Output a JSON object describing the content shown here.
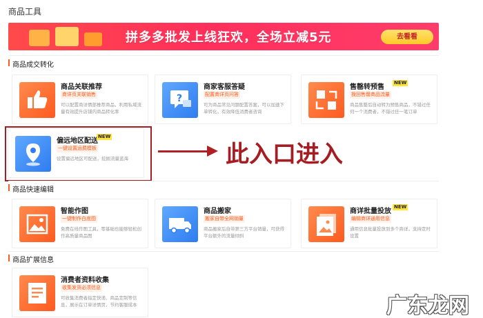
{
  "header": {
    "title": "商品工具"
  },
  "banner": {
    "text": "拼多多批发上线狂欢，全场立减5元",
    "button": "去看看"
  },
  "sections": {
    "conversion": "商品成交转化",
    "quick_edit": "商品快速编辑",
    "extend": "商品扩展信息"
  },
  "cards": {
    "c1": {
      "name": "商品关联推荐",
      "tag": "商详页关联销售",
      "desc": "可以配置商详情部推荐商品，利用私域流量有效提升店铺内商品转化率",
      "icon": "thumbs-up-icon",
      "color": "#ff5a1f"
    },
    "c2": {
      "name": "商家客服答疑",
      "tag": "配置商详页问答",
      "desc": "可为商品常见问题配置答案，可以加速下单转化，有效降低消费者咨询",
      "icon": "chat-question-icon",
      "color": "#2f7cf0"
    },
    "c3": {
      "name": "售罄转预售",
      "new": "NEW",
      "tag": "挽回售罄商品流量",
      "desc": "商品售罄后自动转为预售商品，不错过任何一个消费者，不错过任一笔订单",
      "icon": "swap-grid-icon",
      "color": "#ff5a1f"
    },
    "c4": {
      "name": "偏远地区配送",
      "new": "NEW",
      "tag": "一键设置运费模板",
      "desc": "设置偏远地区可配送，挖掘流量蓝海",
      "icon": "location-pin-icon",
      "color": "#2f7cf0"
    },
    "c5": {
      "name": "智能作图",
      "tag": "一键制作白底图",
      "desc": "免费在线作图工具，零基础也能够轻松创作高质量商品图",
      "icon": "image-icon",
      "color": "#ff5a1f"
    },
    "c6": {
      "name": "商品搬家",
      "tag": "搬家自带全网销量",
      "desc": "商品搬家后自带第三方平台销量，可获得平台额外的流量倾斜",
      "icon": "truck-icon",
      "color": "#2f7cf0"
    },
    "c7": {
      "name": "商详批量投放",
      "new": "NEW",
      "tag": "编辑商详通用信息",
      "desc": "通用信息批量投放到多个商详，支持定时设置",
      "icon": "layers-icon",
      "color": "#ff5a1f"
    },
    "c8": {
      "name": "消费者资料收集",
      "tag": "收集发货必须信息",
      "desc": "可收集消费者指定快递、商品定制等信息，展示在订单详情页，节约客服成本",
      "icon": "document-icon",
      "color": "#ff5a1f"
    }
  },
  "annotation": {
    "text": "此入口进入"
  },
  "watermark": "广东龙网"
}
